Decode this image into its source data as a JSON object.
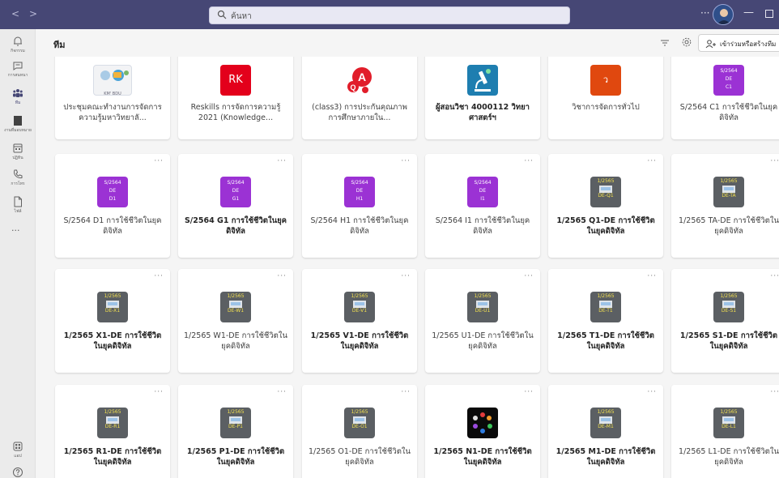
{
  "titlebar": {
    "search_placeholder": "ค้นหา",
    "more": "···"
  },
  "rail": [
    {
      "id": "activity",
      "label": "กิจกรรม"
    },
    {
      "id": "chat",
      "label": "การสนทนา"
    },
    {
      "id": "teams",
      "label": "ทีม"
    },
    {
      "id": "assignments",
      "label": "งานที่มอบหมาย"
    },
    {
      "id": "calendar",
      "label": "ปฏิทิน"
    },
    {
      "id": "calls",
      "label": "การโทร"
    },
    {
      "id": "files",
      "label": "ไฟล์"
    },
    {
      "id": "apps",
      "label": "แอป"
    }
  ],
  "rail_more": "···",
  "header": {
    "title": "ทีม",
    "join_label": "เข้าร่วมหรือสร้างทีม"
  },
  "colors": {
    "titlebar": "#464775",
    "purple_tile": "#9b32d4",
    "gray_tile": "#5b5f63",
    "rk_tile": "#e3001b",
    "orange_tile": "#e0480f"
  },
  "cards": [
    {
      "name": "ประชุมคณะทำงานการจัดการความรู้มหาวิทยาลั...",
      "bold": false,
      "tile": "km",
      "tile_text": [
        "KM' BDU"
      ]
    },
    {
      "name": "Reskills การจัดการความรู้ 2021 (Knowledge...",
      "bold": false,
      "tile": "rk",
      "tile_text": [
        "RK"
      ]
    },
    {
      "name": "(class3) การประกันคุณภาพการศึกษาภายใน...",
      "bold": false,
      "tile": "qa",
      "tile_text": [
        "A",
        "Q"
      ]
    },
    {
      "name": "ผู้สอนวิชา 4000112 วิทยาศาสตร์ฯ",
      "bold": true,
      "tile": "sci",
      "tile_text": []
    },
    {
      "name": "วิชาการจัดการทั่วไป",
      "bold": false,
      "tile": "orange",
      "tile_text": [
        "ว"
      ]
    },
    {
      "name": "S/2564 C1 การใช้ชีวิตในยุคดิจิทัล",
      "bold": false,
      "tile": "purple",
      "tile_text": [
        "S/2564",
        "DE",
        "C1"
      ]
    },
    {
      "name": "S/2564 D1 การใช้ชีวิตในยุคดิจิทัล",
      "bold": false,
      "tile": "purple",
      "tile_text": [
        "S/2564",
        "DE",
        "D1"
      ]
    },
    {
      "name": "S/2564 G1 การใช้ชีวิตในยุคดิจิทัล",
      "bold": true,
      "tile": "purple",
      "tile_text": [
        "S/2564",
        "DE",
        "G1"
      ]
    },
    {
      "name": "S/2564 H1 การใช้ชีวิตในยุคดิจิทัล",
      "bold": false,
      "tile": "purple",
      "tile_text": [
        "S/2564",
        "DE",
        "H1"
      ]
    },
    {
      "name": "S/2564 I1 การใช้ชีวิตในยุคดิจิทัล",
      "bold": false,
      "tile": "purple",
      "tile_text": [
        "S/2564",
        "DE",
        "I1"
      ]
    },
    {
      "name": "1/2565 Q1-DE การใช้ชีวิตในยุคดิจิทัล",
      "bold": true,
      "tile": "gray",
      "tile_text": [
        "1/2565",
        "DE-Q1"
      ]
    },
    {
      "name": "1/2565 TA-DE การใช้ชีวิตในยุคดิจิทัล",
      "bold": false,
      "tile": "gray",
      "tile_text": [
        "1/2565",
        "DE-TA"
      ]
    },
    {
      "name": "1/2565 X1-DE การใช้ชีวิตในยุคดิจิทัล",
      "bold": true,
      "tile": "gray",
      "tile_text": [
        "1/2565",
        "DE-X1"
      ]
    },
    {
      "name": "1/2565 W1-DE การใช้ชีวิตในยุคดิจิทัล",
      "bold": false,
      "tile": "gray",
      "tile_text": [
        "1/2565",
        "DE-W1"
      ]
    },
    {
      "name": "1/2565 V1-DE การใช้ชีวิตในยุคดิจิทัล",
      "bold": true,
      "tile": "gray",
      "tile_text": [
        "1/2565",
        "DE-V1"
      ]
    },
    {
      "name": "1/2565 U1-DE การใช้ชีวิตในยุคดิจิทัล",
      "bold": false,
      "tile": "gray",
      "tile_text": [
        "1/2565",
        "DE-U1"
      ]
    },
    {
      "name": "1/2565 T1-DE การใช้ชีวิตในยุคดิจิทัล",
      "bold": true,
      "tile": "gray",
      "tile_text": [
        "1/2565",
        "DE-T1"
      ]
    },
    {
      "name": "1/2565 S1-DE การใช้ชีวิตในยุคดิจิทัล",
      "bold": true,
      "tile": "gray",
      "tile_text": [
        "1/2565",
        "DE-S1"
      ]
    },
    {
      "name": "1/2565 R1-DE การใช้ชีวิตในยุคดิจิทัล",
      "bold": true,
      "tile": "gray",
      "tile_text": [
        "1/2565",
        "DE-R1"
      ]
    },
    {
      "name": "1/2565 P1-DE การใช้ชีวิตในยุคดิจิทัล",
      "bold": true,
      "tile": "gray",
      "tile_text": [
        "1/2565",
        "DE-P1"
      ]
    },
    {
      "name": "1/2565 O1-DE การใช้ชีวิตในยุคดิจิทัล",
      "bold": false,
      "tile": "gray",
      "tile_text": [
        "1/2565",
        "DE-O1"
      ]
    },
    {
      "name": "1/2565 N1-DE การใช้ชีวิตในยุคดิจิทัล",
      "bold": true,
      "tile": "dark",
      "tile_text": []
    },
    {
      "name": "1/2565 M1-DE การใช้ชีวิตในยุคดิจิทัล",
      "bold": true,
      "tile": "gray",
      "tile_text": [
        "1/2565",
        "DE-M1"
      ]
    },
    {
      "name": "1/2565 L1-DE การใช้ชีวิตในยุคดิจิทัล",
      "bold": false,
      "tile": "gray",
      "tile_text": [
        "1/2565",
        "DE-L1"
      ]
    }
  ]
}
